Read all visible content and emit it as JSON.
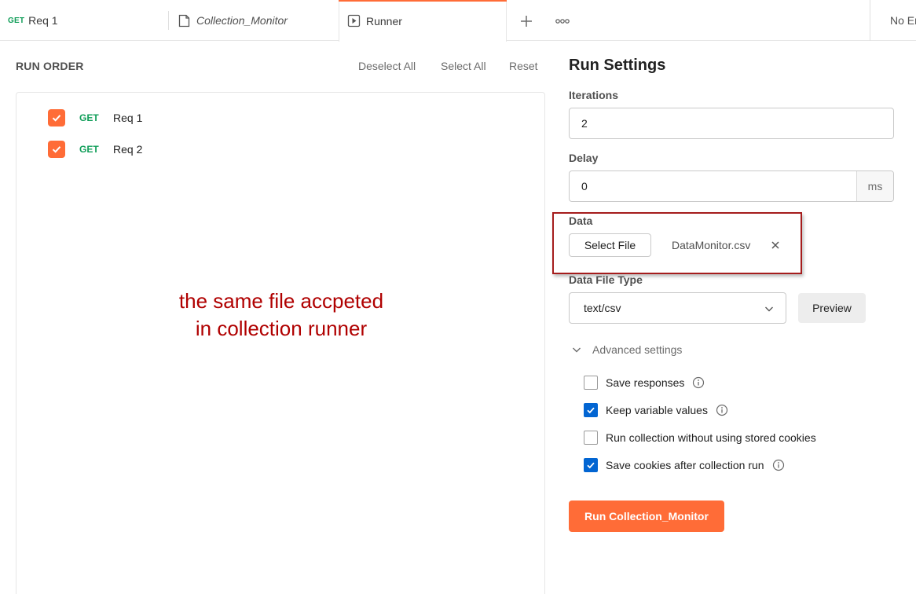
{
  "tabs": {
    "req1": {
      "method": "GET",
      "label": "Req 1"
    },
    "collection": {
      "label": "Collection_Monitor"
    },
    "runner": {
      "label": "Runner"
    },
    "more_icon": "ooo",
    "environment": "No Environment"
  },
  "run_order": {
    "title": "RUN ORDER",
    "deselect_all": "Deselect All",
    "select_all": "Select All",
    "reset": "Reset",
    "requests": [
      {
        "method": "GET",
        "name": "Req 1",
        "checked": true
      },
      {
        "method": "GET",
        "name": "Req 2",
        "checked": true
      }
    ],
    "annotation_line1": "the same file accpeted",
    "annotation_line2": "in collection runner"
  },
  "run_settings": {
    "title": "Run Settings",
    "iterations_label": "Iterations",
    "iterations_value": "2",
    "delay_label": "Delay",
    "delay_value": "0",
    "delay_unit": "ms",
    "data_label": "Data",
    "select_file": "Select File",
    "file_name": "DataMonitor.csv",
    "data_file_type_label": "Data File Type",
    "data_file_type_value": "text/csv",
    "preview": "Preview",
    "advanced_settings": "Advanced settings",
    "options": [
      {
        "label": "Save responses",
        "checked": false
      },
      {
        "label": "Keep variable values",
        "checked": true
      },
      {
        "label": "Run collection without using stored cookies",
        "checked": false
      },
      {
        "label": "Save cookies after collection run",
        "checked": true
      }
    ],
    "run_button": "Run Collection_Monitor"
  },
  "colors": {
    "accent": "#ff6c37",
    "checkbox_blue": "#0265d2",
    "get_method": "#0f9d58",
    "annotation": "#b00000"
  }
}
